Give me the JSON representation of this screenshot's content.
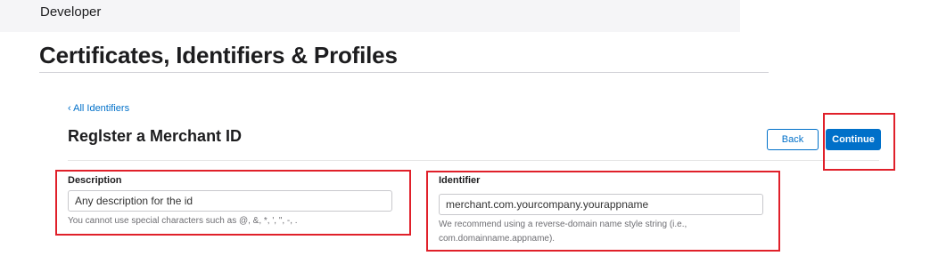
{
  "header": {
    "brand": "Developer",
    "apple_glyph": "",
    "page_title": "Certificates, Identifiers & Profiles"
  },
  "register": {
    "breadcrumb": "‹ All Identifiers",
    "title": "Reglster a Merchant ID",
    "back_label": "Back",
    "continue_label": "Continue"
  },
  "description": {
    "label": "Description",
    "value": "Any description for the id",
    "help": "You cannot use special characters such as @, &, *, ', \", -, ."
  },
  "identifier": {
    "label": "Identifier",
    "value": "merchant.com.yourcompany.yourappname",
    "help_line1": "We recommend using a reverse-domain name style string (i.e.,",
    "help_line2": "com.domainname.appname)."
  },
  "colors": {
    "accent": "#0070c9",
    "highlight": "#e0202a"
  }
}
